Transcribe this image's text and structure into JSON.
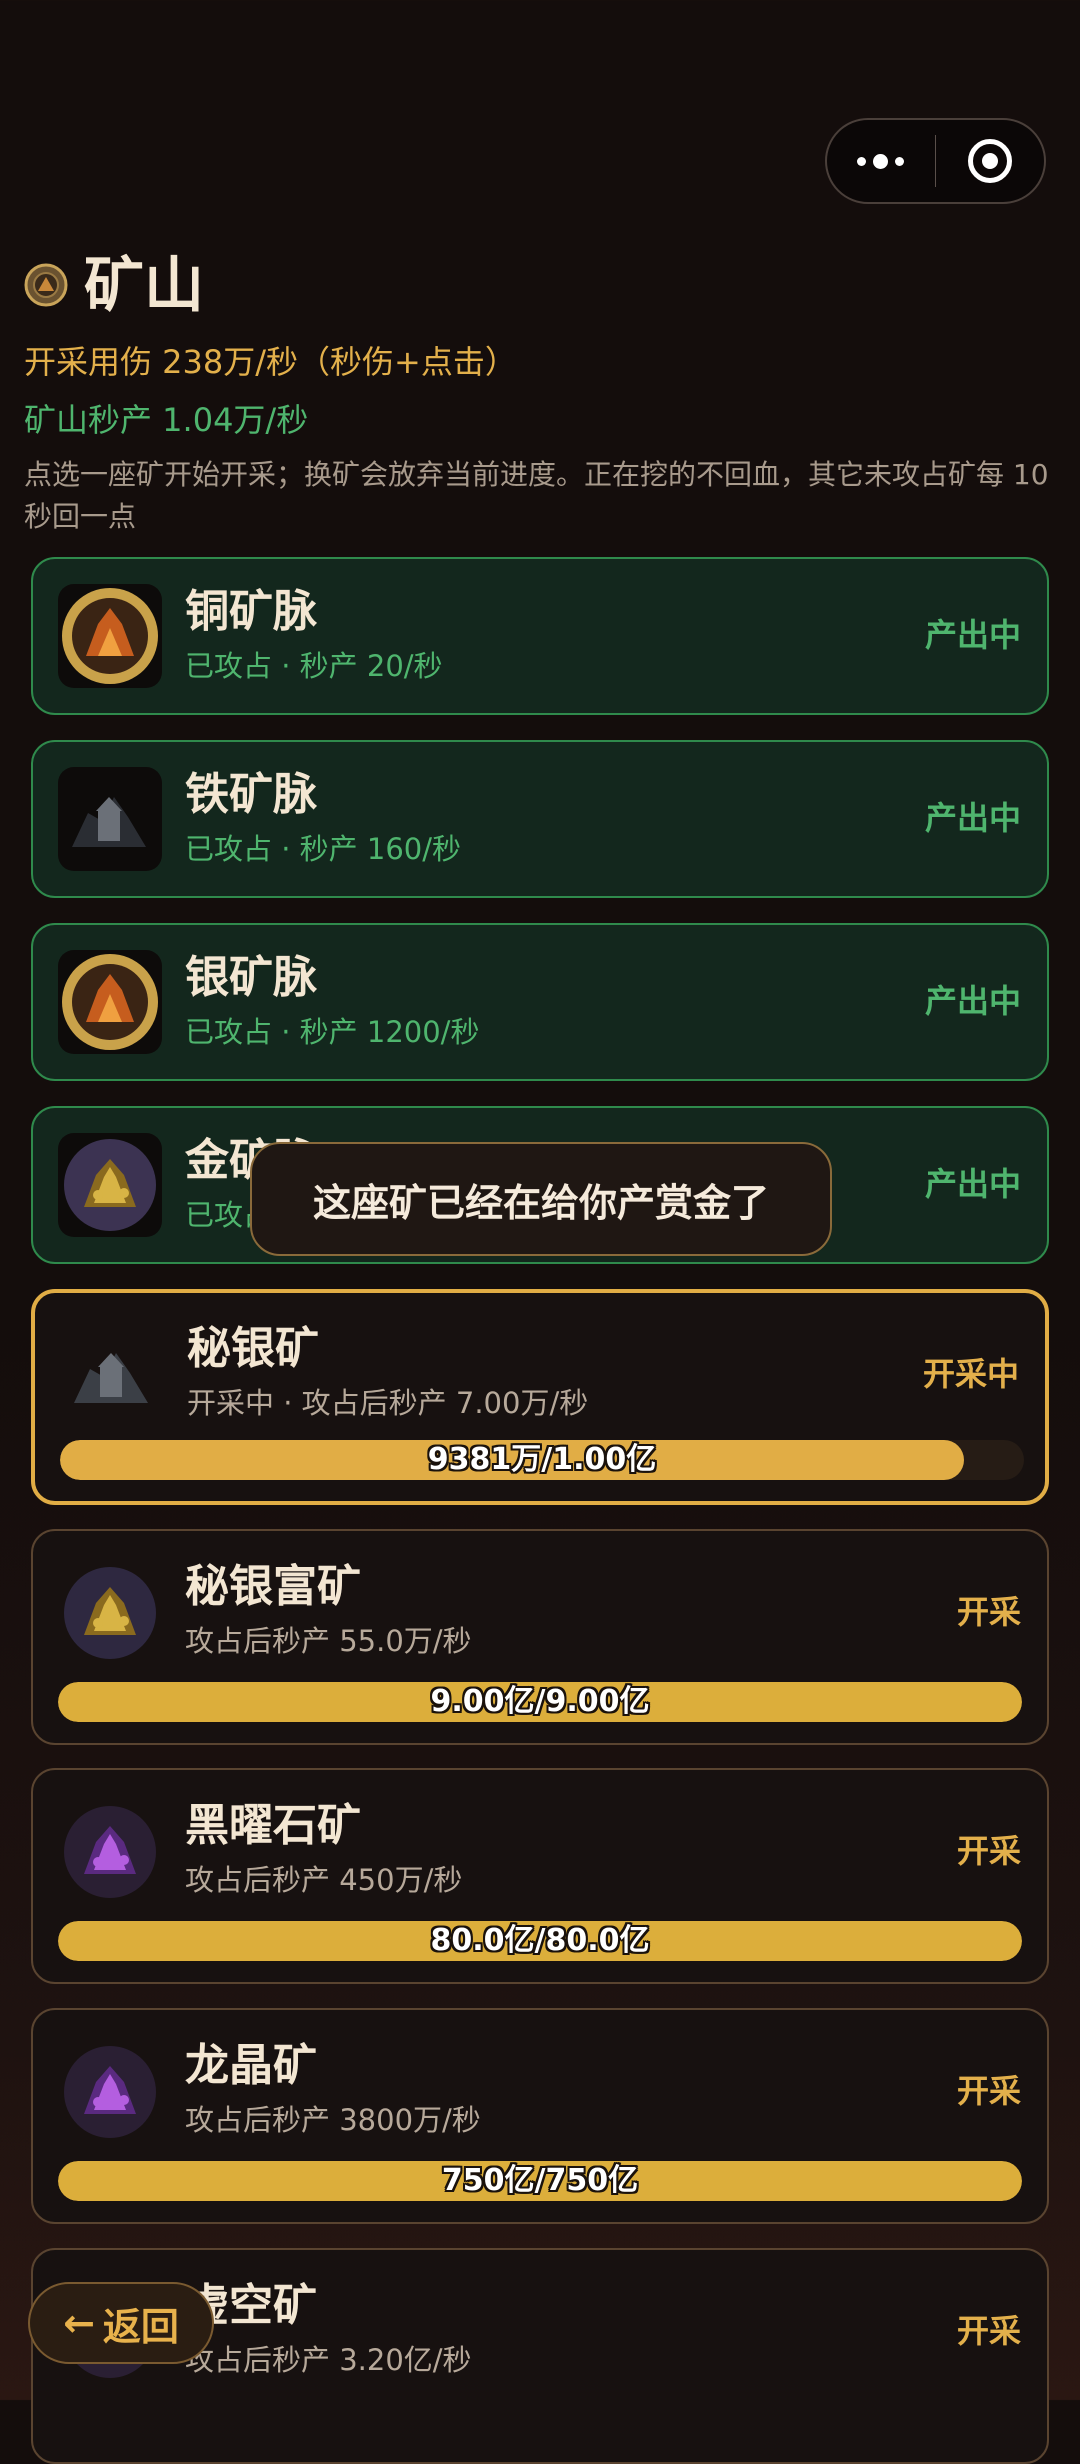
{
  "colors": {
    "gold": "#e3b04b",
    "green": "#4fb56e",
    "bar_gold": "#dcae3b",
    "mining_border": "#e1ad45"
  },
  "topbar": {
    "more_icon": "more-dots-icon",
    "close_icon": "capsule-close-icon"
  },
  "header": {
    "icon": "mine-emblem-icon",
    "title": "矿山",
    "dps_line": "开采用伤 238万/秒（秒伤+点击）",
    "output_line": "矿山秒产 1.04万/秒",
    "hint": "点选一座矿开始开采；换矿会放弃当前进度。正在挖的不回血，其它未攻占矿每 10 秒回一点"
  },
  "mines": [
    {
      "name": "铜矿脉",
      "sub": "已攻占 · 秒产 20/秒",
      "status": "产出中",
      "state": "owned",
      "icon": "copper-ore-icon"
    },
    {
      "name": "铁矿脉",
      "sub": "已攻占 · 秒产 160/秒",
      "status": "产出中",
      "state": "owned",
      "icon": "iron-ore-icon"
    },
    {
      "name": "银矿脉",
      "sub": "已攻占 · 秒产 1200/秒",
      "status": "产出中",
      "state": "owned",
      "icon": "silver-ore-icon"
    },
    {
      "name": "金矿脉",
      "sub": "已攻占 · 秒产 1.00万/秒",
      "status": "产出中",
      "state": "owned",
      "icon": "gold-ore-icon"
    },
    {
      "name": "秘银矿",
      "sub": "开采中 · 攻占后秒产 7.00万/秒",
      "status": "开采中",
      "state": "mining",
      "icon": "mithril-ore-icon",
      "progress_text": "9381万/1.00亿",
      "progress": 0.938
    },
    {
      "name": "秘银富矿",
      "sub": "攻占后秒产 55.0万/秒",
      "status": "开采",
      "state": "available",
      "icon": "rich-mithril-ore-icon",
      "progress_text": "9.00亿/9.00亿",
      "progress": 1.0
    },
    {
      "name": "黑曜石矿",
      "sub": "攻占后秒产 450万/秒",
      "status": "开采",
      "state": "available",
      "icon": "obsidian-ore-icon",
      "progress_text": "80.0亿/80.0亿",
      "progress": 1.0
    },
    {
      "name": "龙晶矿",
      "sub": "攻占后秒产 3800万/秒",
      "status": "开采",
      "state": "available",
      "icon": "dragon-crystal-ore-icon",
      "progress_text": "750亿/750亿",
      "progress": 1.0
    },
    {
      "name": "虚空矿",
      "sub": "攻占后秒产 3.20亿/秒",
      "status": "开采",
      "state": "available",
      "icon": "void-ore-icon"
    }
  ],
  "toast": "这座矿已经在给你产赏金了",
  "back_button": {
    "arrow": "←",
    "label": "返回"
  }
}
